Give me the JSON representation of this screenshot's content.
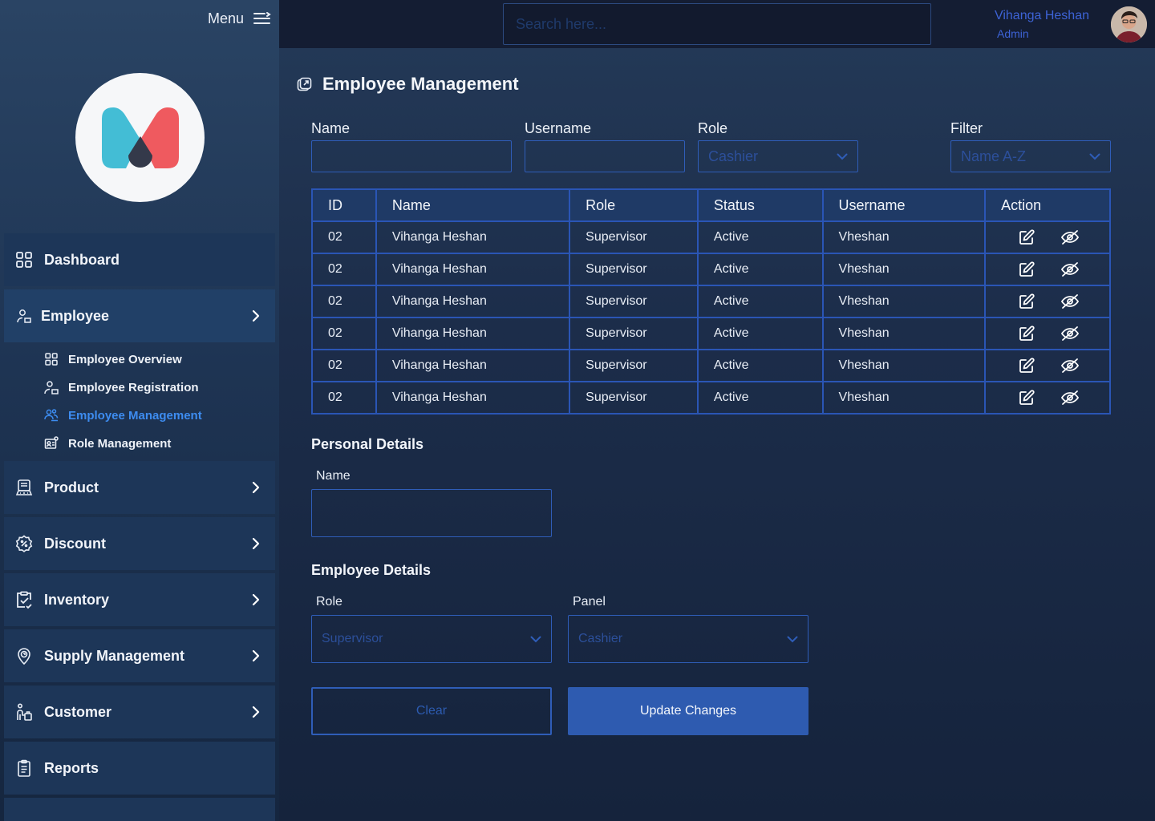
{
  "sidebar": {
    "menu_label": "Menu",
    "nav": [
      {
        "label": "Dashboard",
        "icon": "dashboard-grid-icon",
        "has_chevron": false
      },
      {
        "label": "Employee",
        "icon": "employee-icon",
        "has_chevron": true,
        "expanded": true
      },
      {
        "label": "Product",
        "icon": "product-icon",
        "has_chevron": true
      },
      {
        "label": "Discount",
        "icon": "discount-badge-icon",
        "has_chevron": true
      },
      {
        "label": "Inventory",
        "icon": "inventory-clipboard-icon",
        "has_chevron": true
      },
      {
        "label": "Supply Management",
        "icon": "supply-pin-icon",
        "has_chevron": true
      },
      {
        "label": "Customer",
        "icon": "customer-icon",
        "has_chevron": true
      },
      {
        "label": "Reports",
        "icon": "reports-icon",
        "has_chevron": false
      }
    ],
    "employee_sub": [
      {
        "label": "Employee Overview",
        "icon": "grid-icon"
      },
      {
        "label": "Employee Registration",
        "icon": "user-add-icon"
      },
      {
        "label": "Employee Management",
        "icon": "users-manage-icon",
        "active": true
      },
      {
        "label": "Role Management",
        "icon": "id-card-icon"
      }
    ]
  },
  "topbar": {
    "search_placeholder": "Search here...",
    "user_name": "Vihanga Heshan",
    "user_role": "Admin"
  },
  "main": {
    "title": "Employee Management",
    "filters": {
      "name_label": "Name",
      "name_value": "",
      "username_label": "Username",
      "username_value": "",
      "role_label": "Role",
      "role_value": "Cashier",
      "filter_label": "Filter",
      "filter_value": "Name A-Z"
    },
    "table": {
      "headers": [
        "ID",
        "Name",
        "Role",
        "Status",
        "Username",
        "Action"
      ],
      "rows": [
        [
          "02",
          "Vihanga Heshan",
          "Supervisor",
          "Active",
          "Vheshan"
        ],
        [
          "02",
          "Vihanga Heshan",
          "Supervisor",
          "Active",
          "Vheshan"
        ],
        [
          "02",
          "Vihanga Heshan",
          "Supervisor",
          "Active",
          "Vheshan"
        ],
        [
          "02",
          "Vihanga Heshan",
          "Supervisor",
          "Active",
          "Vheshan"
        ],
        [
          "02",
          "Vihanga Heshan",
          "Supervisor",
          "Active",
          "Vheshan"
        ],
        [
          "02",
          "Vihanga Heshan",
          "Supervisor",
          "Active",
          "Vheshan"
        ]
      ]
    },
    "personal": {
      "title": "Personal Details",
      "name_label": "Name",
      "name_value": ""
    },
    "employee_details": {
      "title": "Employee Details",
      "role_label": "Role",
      "role_value": "Supervisor",
      "panel_label": "Panel",
      "panel_value": "Cashier"
    },
    "buttons": {
      "clear": "Clear",
      "update": "Update Changes"
    }
  },
  "colors": {
    "accent_blue": "#2e5bb0",
    "active_link": "#3d8cf0",
    "logo_cyan": "#43bdd5",
    "logo_red": "#ef5a5f",
    "logo_dark": "#34394a"
  }
}
